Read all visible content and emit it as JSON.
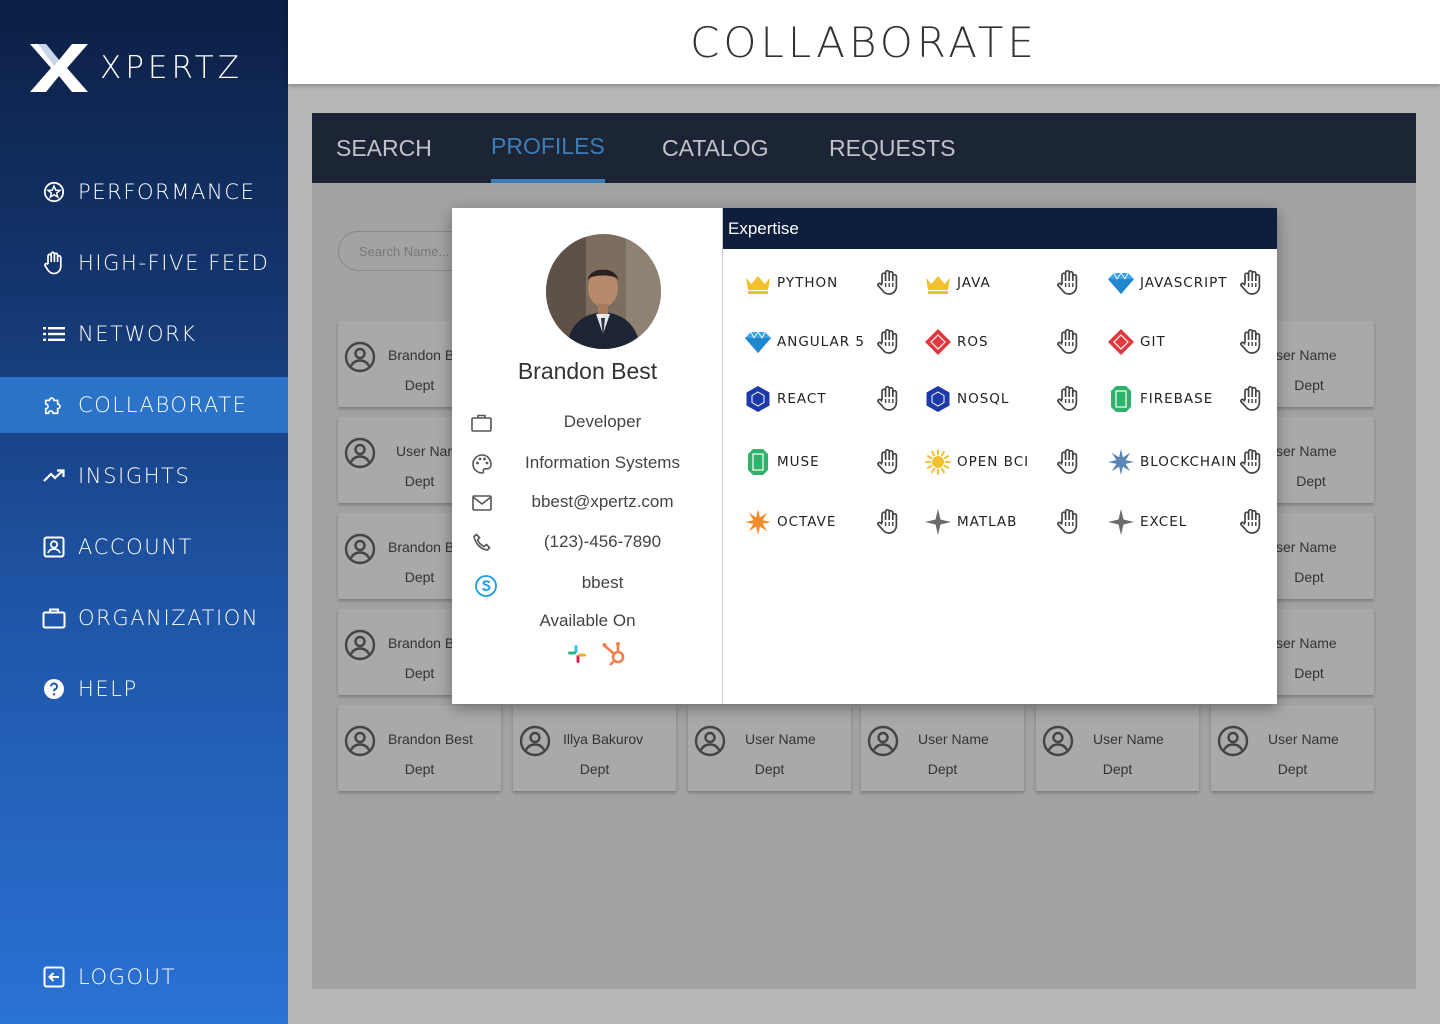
{
  "brand": {
    "name": "XPERTZ"
  },
  "sidebar": {
    "items": [
      {
        "label": "PERFORMANCE",
        "icon": "star-circle-icon"
      },
      {
        "label": "HIGH-FIVE FEED",
        "icon": "hand-icon"
      },
      {
        "label": "NETWORK",
        "icon": "list-icon"
      },
      {
        "label": "COLLABORATE",
        "icon": "puzzle-icon",
        "active": true
      },
      {
        "label": "INSIGHTS",
        "icon": "trending-up-icon"
      },
      {
        "label": "ACCOUNT",
        "icon": "account-box-icon"
      },
      {
        "label": "ORGANIZATION",
        "icon": "briefcase-icon"
      },
      {
        "label": "HELP",
        "icon": "help-circle-icon"
      }
    ],
    "logout": "LOGOUT"
  },
  "header": {
    "title": "COLLABORATE"
  },
  "tabs": [
    {
      "label": "SEARCH"
    },
    {
      "label": "PROFILES",
      "active": true
    },
    {
      "label": "CATALOG"
    },
    {
      "label": "REQUESTS"
    }
  ],
  "search": {
    "placeholder": "Search Name..."
  },
  "grid": {
    "left_cards": [
      {
        "name": "Brandon B",
        "dept": "Dept"
      },
      {
        "name": "User Nar",
        "dept": "Dept"
      },
      {
        "name": "Brandon B",
        "dept": "Dept"
      },
      {
        "name": "Brandon B",
        "dept": "Dept"
      }
    ],
    "right_cards": [
      {
        "name": "ser Name",
        "dept": "Dept"
      },
      {
        "name": "ser Name",
        "dept": "Dept"
      },
      {
        "name": "ser Name",
        "dept": "Dept"
      },
      {
        "name": "ser Name",
        "dept": "Dept"
      }
    ],
    "bottom_row": [
      {
        "name": "Brandon Best",
        "dept": "Dept"
      },
      {
        "name": "Illya Bakurov",
        "dept": "Dept"
      },
      {
        "name": "User Name",
        "dept": "Dept"
      },
      {
        "name": "User Name",
        "dept": "Dept"
      },
      {
        "name": "User Name",
        "dept": "Dept"
      },
      {
        "name": "User Name",
        "dept": "Dept"
      }
    ]
  },
  "profile": {
    "name": "Brandon Best",
    "title": "Developer",
    "department": "Information Systems",
    "email": "bbest@xpertz.com",
    "phone": "(123)-456-7890",
    "skype": "bbest",
    "available_on_label": "Available On",
    "apps": [
      "slack-icon",
      "hubspot-icon"
    ]
  },
  "expertise": {
    "heading": "Expertise",
    "skills": [
      {
        "name": "PYTHON",
        "icon": "crown-icon",
        "color": "#f2c12e"
      },
      {
        "name": "JAVA",
        "icon": "crown-icon",
        "color": "#f2c12e"
      },
      {
        "name": "JAVASCRIPT",
        "icon": "diamond-icon",
        "color": "#3ba3e8"
      },
      {
        "name": "ANGULAR 5",
        "icon": "diamond-icon",
        "color": "#3ba3e8"
      },
      {
        "name": "ROS",
        "icon": "ruby-icon",
        "color": "#e0383e"
      },
      {
        "name": "GIT",
        "icon": "ruby-icon",
        "color": "#e0383e"
      },
      {
        "name": "REACT",
        "icon": "sapphire-icon",
        "color": "#1d3aa8"
      },
      {
        "name": "NOSQL",
        "icon": "sapphire-icon",
        "color": "#1d3aa8"
      },
      {
        "name": "FIREBASE",
        "icon": "emerald-icon",
        "color": "#2fb36a"
      },
      {
        "name": "MUSE",
        "icon": "emerald-icon",
        "color": "#2fb36a"
      },
      {
        "name": "OPEN BCI",
        "icon": "sun-icon",
        "color": "#f2c12e"
      },
      {
        "name": "BLOCKCHAIN",
        "icon": "starburst-icon",
        "color": "#5a86b5"
      },
      {
        "name": "OCTAVE",
        "icon": "starburst-icon",
        "color": "#f28c28"
      },
      {
        "name": "MATLAB",
        "icon": "sparkle-icon",
        "color": "#6b6b6b"
      },
      {
        "name": "EXCEL",
        "icon": "sparkle-icon",
        "color": "#6b6b6b"
      }
    ]
  }
}
